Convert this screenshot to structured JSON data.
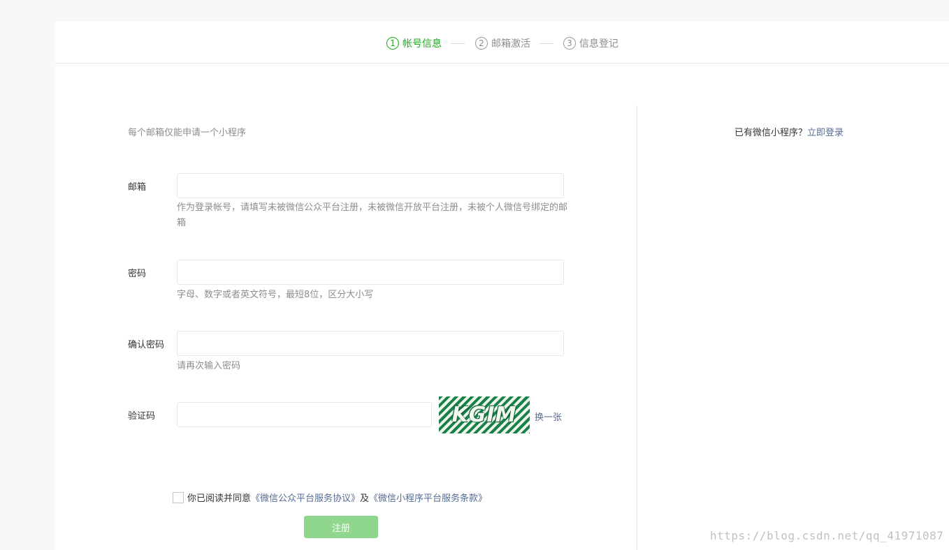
{
  "steps": [
    {
      "number": "1",
      "label": "帐号信息",
      "active": true
    },
    {
      "number": "2",
      "label": "邮箱激活",
      "active": false
    },
    {
      "number": "3",
      "label": "信息登记",
      "active": false
    }
  ],
  "form": {
    "tip": "每个邮箱仅能申请一个小程序",
    "email": {
      "label": "邮箱",
      "value": "",
      "placeholder": "",
      "hint": "作为登录帐号，请填写未被微信公众平台注册，未被微信开放平台注册，未被个人微信号绑定的邮箱"
    },
    "password": {
      "label": "密码",
      "value": "",
      "placeholder": "",
      "hint": "字母、数字或者英文符号，最短8位，区分大小写"
    },
    "confirm_password": {
      "label": "确认密码",
      "value": "",
      "placeholder": "",
      "hint": "请再次输入密码"
    },
    "captcha": {
      "label": "验证码",
      "value": "",
      "placeholder": "",
      "image_text": "KGIM",
      "refresh_label": "换一张"
    },
    "agreement": {
      "prefix": "你已阅读并同意",
      "link1": "《微信公众平台服务协议》",
      "middle": "及",
      "link2": "《微信小程序平台服务条款》",
      "checked": false
    },
    "submit_label": "注册"
  },
  "side": {
    "question": "已有微信小程序？",
    "login_link": "立即登录"
  },
  "watermark": "https://blog.csdn.net/qq_41971087",
  "colors": {
    "accent_green": "#1aad19",
    "button_disabled": "#8fd78e",
    "link": "#576b95",
    "hint_text": "#8d8d8d",
    "border": "#e7e7eb",
    "captcha_green": "#188149"
  }
}
